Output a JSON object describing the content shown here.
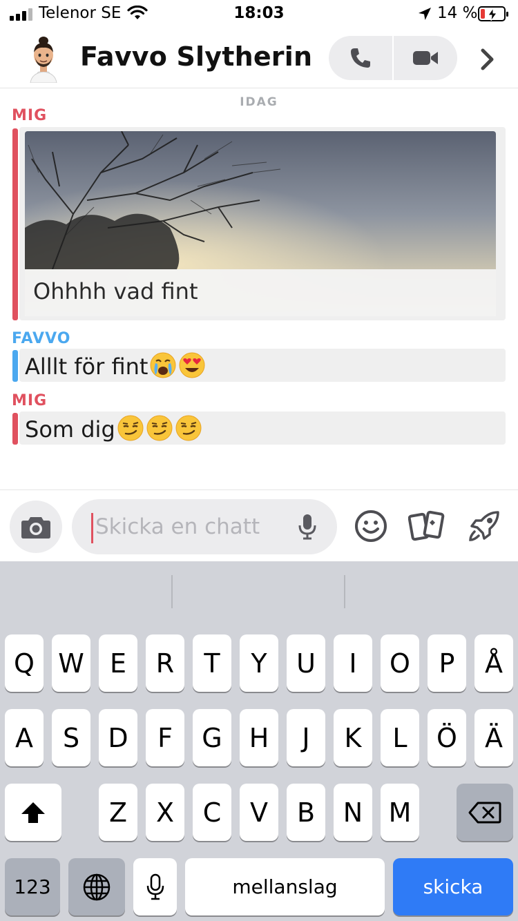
{
  "status_bar": {
    "carrier": "Telenor SE",
    "time": "18:03",
    "battery_percent": "14 %",
    "battery_level": 0.14,
    "battery_charging": true,
    "signal_bars": 3
  },
  "header": {
    "title": "Favvo Slytherin",
    "avatar_icon": "bitmoji-avatar",
    "call_icon": "phone-icon",
    "video_icon": "video-camera-icon",
    "more_icon": "chevron-right-icon"
  },
  "chat": {
    "date_separator": "IDAG",
    "messages": [
      {
        "sender": "MIG",
        "kind": "photo",
        "caption": "Ohhhh vad fint",
        "color": "#e0515f"
      },
      {
        "sender": "FAVVO",
        "kind": "text",
        "text": "Alllt för fint",
        "emojis": [
          "crying-emoji",
          "heart-eyes-emoji"
        ],
        "color": "#4ba8ef"
      },
      {
        "sender": "MIG",
        "kind": "text",
        "text": "Som dig",
        "emojis": [
          "smirk-emoji",
          "smirk-emoji",
          "smirk-emoji"
        ],
        "color": "#e0515f"
      }
    ]
  },
  "input_bar": {
    "placeholder": "Skicka en chatt",
    "camera_icon": "camera-icon",
    "mic_icon": "microphone-icon",
    "tools": [
      "smiley-icon",
      "cards-icon",
      "rocket-icon"
    ]
  },
  "keyboard": {
    "row1": [
      "Q",
      "W",
      "E",
      "R",
      "T",
      "Y",
      "U",
      "I",
      "O",
      "P",
      "Å"
    ],
    "row2": [
      "A",
      "S",
      "D",
      "F",
      "G",
      "H",
      "J",
      "K",
      "L",
      "Ö",
      "Ä"
    ],
    "row3": [
      "Z",
      "X",
      "C",
      "V",
      "B",
      "N",
      "M"
    ],
    "numbers_label": "123",
    "space_label": "mellanslag",
    "return_label": "skicka",
    "shift_icon": "shift-arrow-icon",
    "delete_icon": "backspace-icon",
    "globe_icon": "globe-icon",
    "dictation_icon": "microphone-icon"
  },
  "colors": {
    "me": "#e0515f",
    "friend": "#4ba8ef",
    "send_key": "#2f7bf6"
  }
}
